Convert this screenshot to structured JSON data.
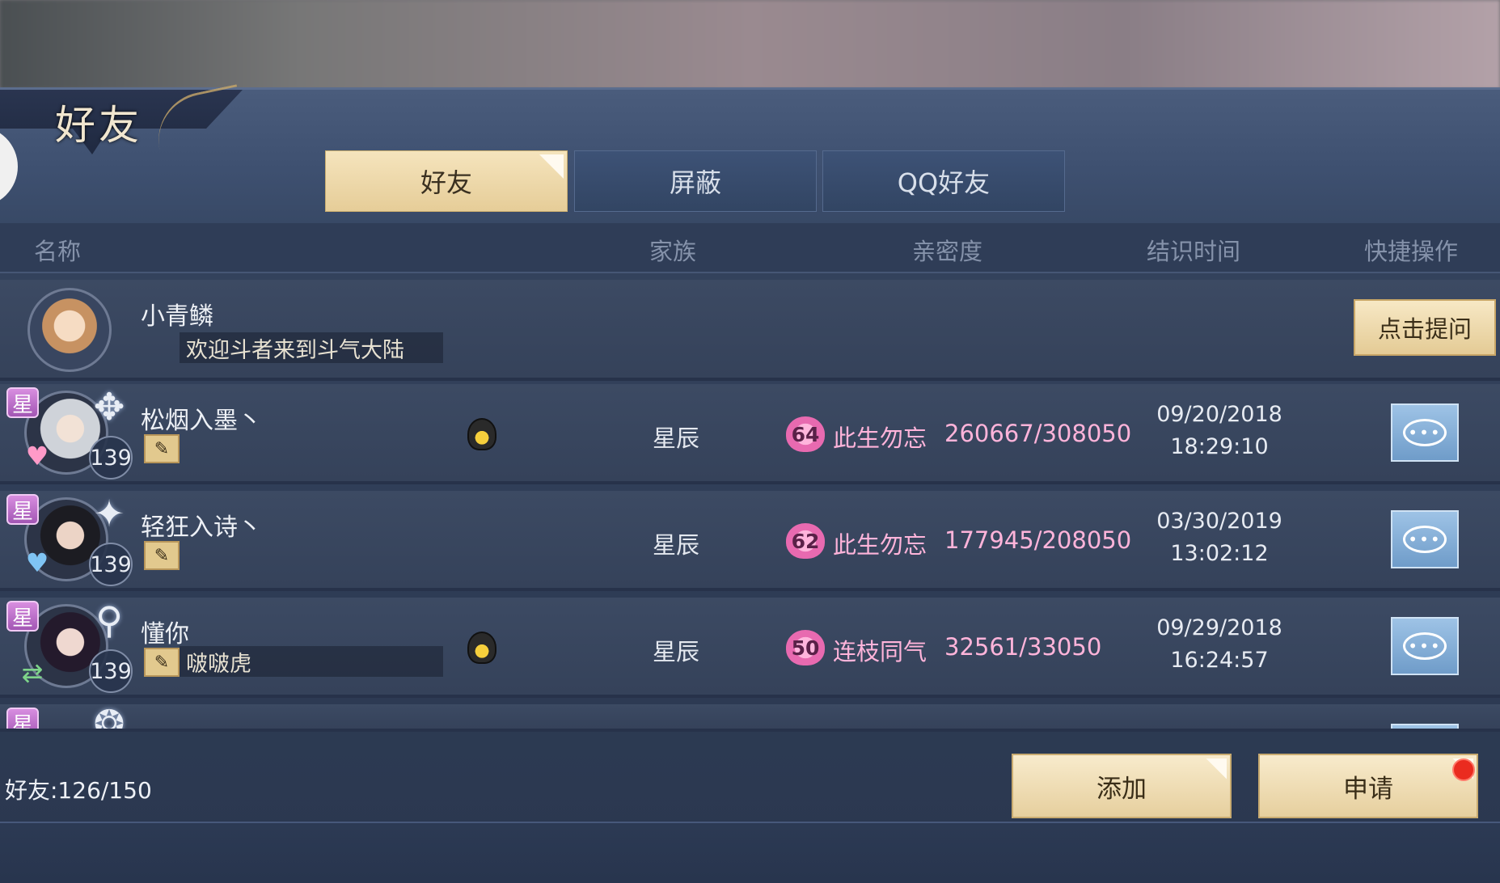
{
  "window": {
    "title": "好友"
  },
  "tabs": [
    {
      "label": "好友",
      "active": true
    },
    {
      "label": "屏蔽",
      "active": false
    },
    {
      "label": "QQ好友",
      "active": false
    }
  ],
  "columns": [
    "名称",
    "家族",
    "亲密度",
    "结识时间",
    "快捷操作"
  ],
  "npc": {
    "name": "小青鳞",
    "message": "欢迎斗者来到斗气大陆",
    "action_label": "点击提问"
  },
  "friends": [
    {
      "star": "星",
      "level": "139",
      "name": "松烟入墨丶",
      "signature": "",
      "has_qq": true,
      "family": "星辰",
      "intimacy_level": "64",
      "intimacy_title": "此生勿忘",
      "intimacy_value": "260667/308050",
      "date": "09/20/2018",
      "time": "18:29:10",
      "heart_icon": "pink-heart-icon"
    },
    {
      "star": "星",
      "level": "139",
      "name": "轻狂入诗丶",
      "signature": "",
      "has_qq": false,
      "family": "星辰",
      "intimacy_level": "62",
      "intimacy_title": "此生勿忘",
      "intimacy_value": "177945/208050",
      "date": "03/30/2019",
      "time": "13:02:12",
      "heart_icon": "blue-heart-icon"
    },
    {
      "star": "星",
      "level": "139",
      "name": "懂你",
      "signature": "啵啵虎",
      "has_qq": true,
      "family": "星辰",
      "intimacy_level": "50",
      "intimacy_title": "连枝同气",
      "intimacy_value": "32561/33050",
      "date": "09/29/2018",
      "time": "16:24:57",
      "heart_icon": "swap-arrows-icon"
    }
  ],
  "partial_row": {
    "star": "星"
  },
  "footer": {
    "friend_count": "好友:126/150",
    "add_label": "添加",
    "apply_label": "申请"
  },
  "colors": {
    "panel": "#33425c",
    "gold_button": "#e6cf9e",
    "intimacy_pink": "#ffb4da",
    "star_purple": "#a256b4",
    "chat_blue": "#6f9cc9",
    "notify_red": "#ea2b1f"
  }
}
